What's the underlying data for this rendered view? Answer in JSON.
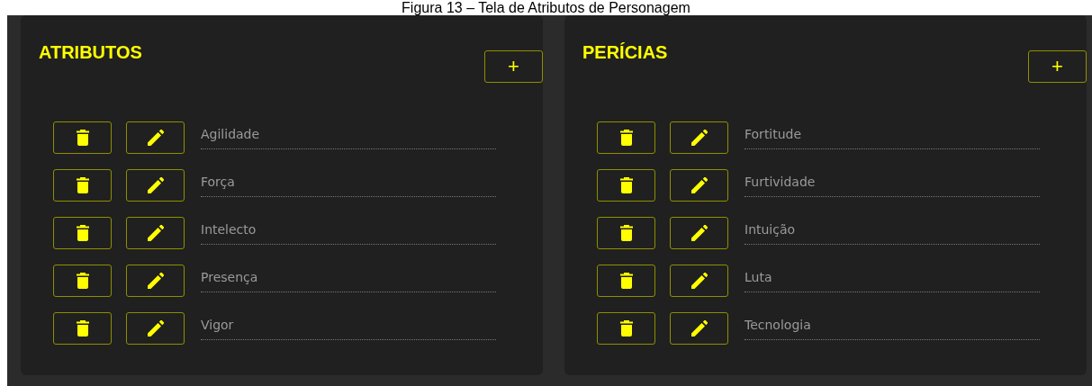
{
  "caption": "Figura 13 – Tela de Atributos de Personagem",
  "panels": [
    {
      "title": "ATRIBUTOS",
      "add_label": "+",
      "items": [
        {
          "value": "Agilidade"
        },
        {
          "value": "Força"
        },
        {
          "value": "Intelecto"
        },
        {
          "value": "Presença"
        },
        {
          "value": "Vigor"
        }
      ]
    },
    {
      "title": "PERÍCIAS",
      "add_label": "+",
      "items": [
        {
          "value": "Fortitude"
        },
        {
          "value": "Furtividade"
        },
        {
          "value": "Intuição"
        },
        {
          "value": "Luta"
        },
        {
          "value": "Tecnologia"
        }
      ]
    }
  ]
}
